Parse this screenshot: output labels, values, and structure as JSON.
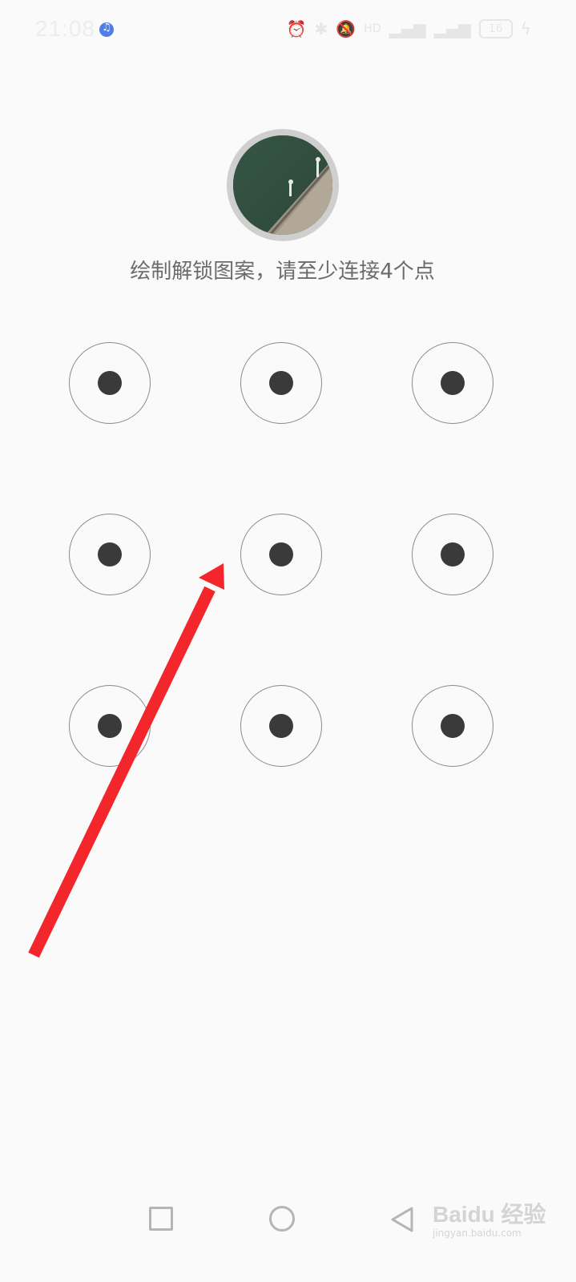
{
  "status_bar": {
    "time": "21:08",
    "battery": "16",
    "icons": [
      "music-icon",
      "alarm-icon",
      "bluetooth-icon",
      "mute-icon",
      "hd-icon",
      "signal-icon",
      "signal-icon",
      "battery-icon",
      "charging-icon"
    ]
  },
  "lock_screen": {
    "prompt": "绘制解锁图案，请至少连接4个点",
    "pattern_nodes": [
      1,
      2,
      3,
      4,
      5,
      6,
      7,
      8,
      9
    ]
  },
  "overlay": {
    "arrow_color": "#f2262b"
  },
  "nav_bar": {
    "buttons": [
      "recent-apps-button",
      "home-button",
      "back-button"
    ]
  },
  "watermark": {
    "brand": "Baidu 经验",
    "url": "jingyan.baidu.com"
  }
}
